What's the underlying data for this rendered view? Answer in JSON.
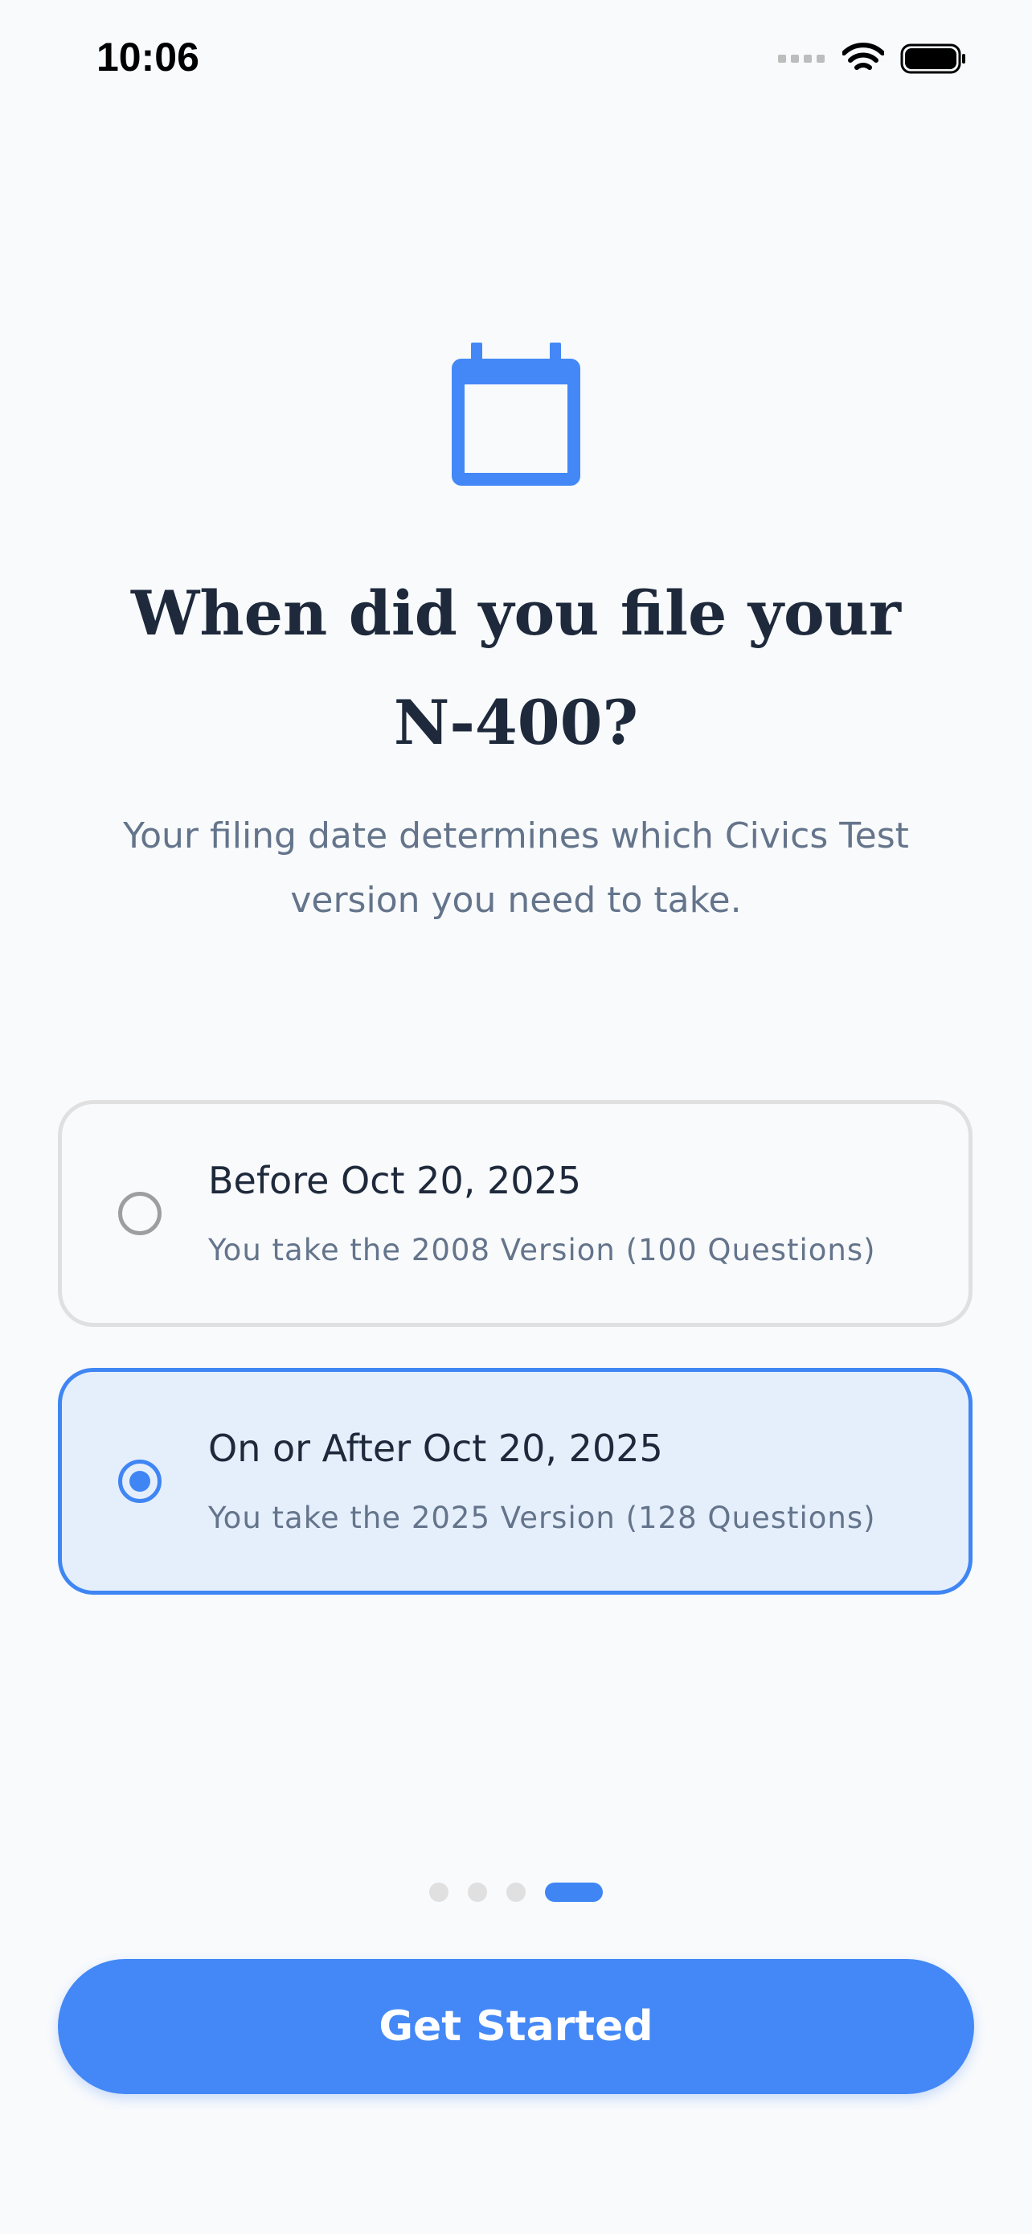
{
  "status_bar": {
    "time": "10:06"
  },
  "screen": {
    "icon": "calendar-icon",
    "title": "When did you file your N-400?",
    "subtitle": "Your filing date determines which Civics Test version you need to take."
  },
  "options": [
    {
      "title": "Before Oct 20, 2025",
      "subtitle": "You take the 2008 Version (100 Questions)",
      "selected": false
    },
    {
      "title": "On or After Oct 20, 2025",
      "subtitle": "You take the 2025 Version (128 Questions)",
      "selected": true
    }
  ],
  "pager": {
    "total": 4,
    "current": 4
  },
  "cta": {
    "label": "Get Started"
  },
  "colors": {
    "accent": "#4388f6",
    "selected_bg": "#e5effc",
    "title": "#1e293b",
    "muted": "#64748b"
  }
}
